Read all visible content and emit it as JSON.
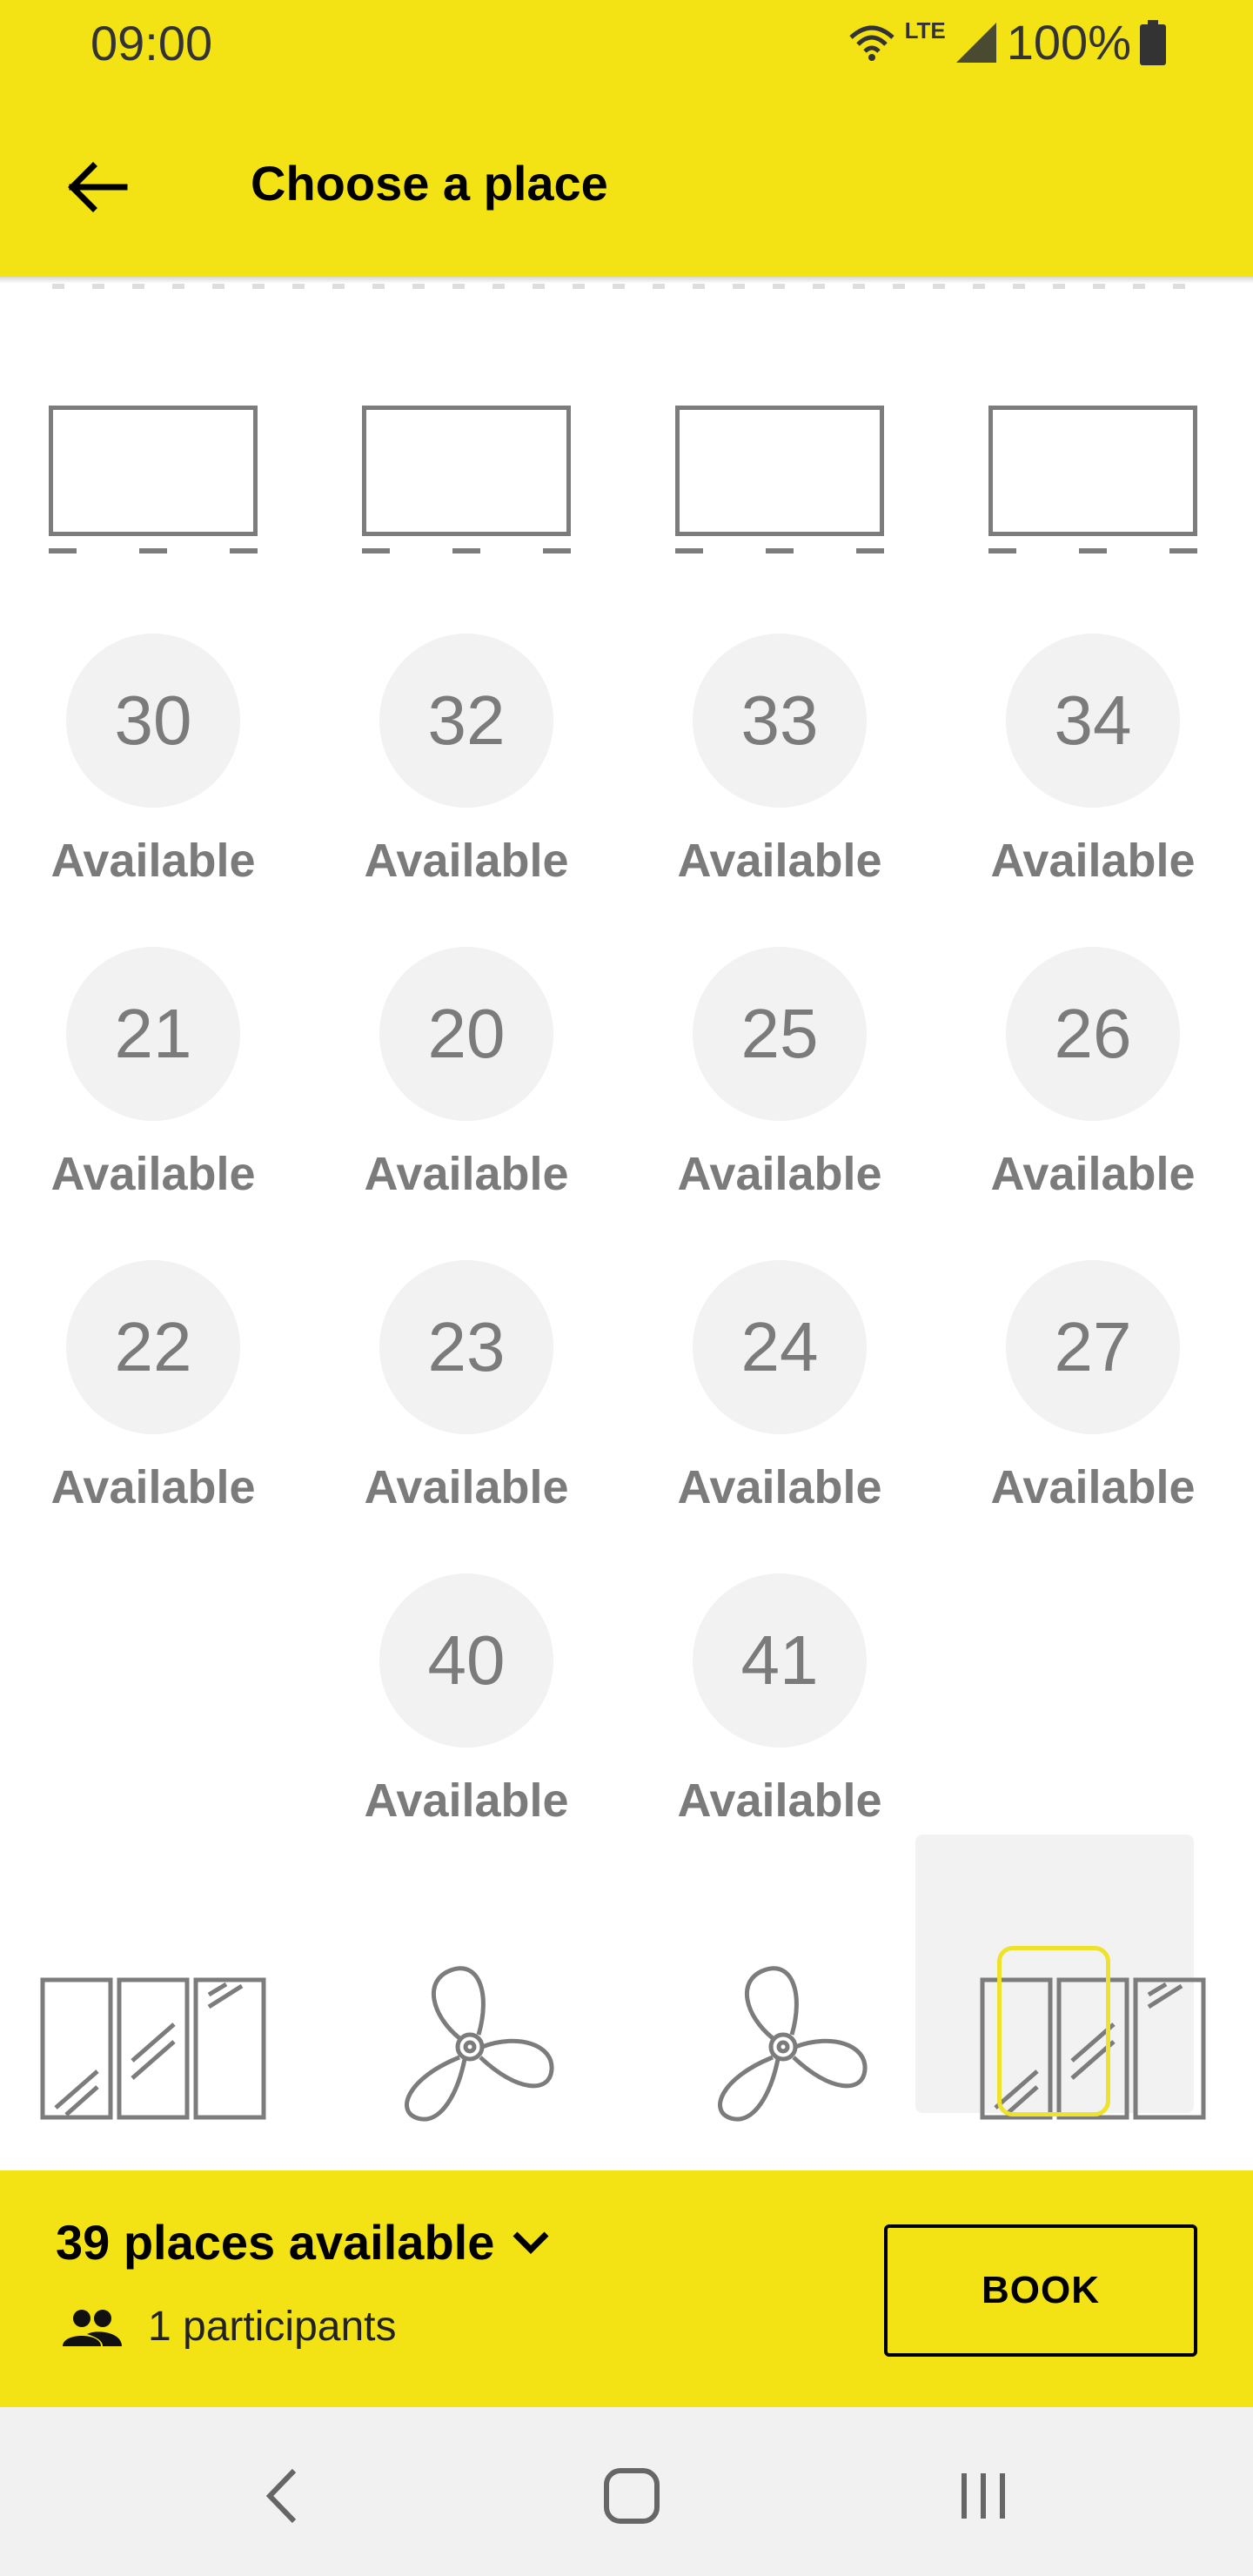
{
  "status_bar": {
    "time": "09:00",
    "network": "LTE",
    "battery": "100%",
    "icons": [
      "wifi-icon",
      "lte-icon",
      "signal-icon",
      "battery-icon"
    ]
  },
  "app_bar": {
    "title": "Choose a place",
    "back_icon": "arrow-left-icon",
    "background": "#f3e315"
  },
  "floor_plan": {
    "screens": 4,
    "seat_rows": [
      [
        {
          "number": "30",
          "status": "Available"
        },
        {
          "number": "32",
          "status": "Available"
        },
        {
          "number": "33",
          "status": "Available"
        },
        {
          "number": "34",
          "status": "Available"
        }
      ],
      [
        {
          "number": "21",
          "status": "Available"
        },
        {
          "number": "20",
          "status": "Available"
        },
        {
          "number": "25",
          "status": "Available"
        },
        {
          "number": "26",
          "status": "Available"
        }
      ],
      [
        {
          "number": "22",
          "status": "Available"
        },
        {
          "number": "23",
          "status": "Available"
        },
        {
          "number": "24",
          "status": "Available"
        },
        {
          "number": "27",
          "status": "Available"
        }
      ],
      [
        {
          "number": "40",
          "status": "Available"
        },
        {
          "number": "41",
          "status": "Available"
        }
      ]
    ],
    "decorations": [
      "window-icon",
      "fan-icon",
      "fan-icon",
      "window-icon"
    ],
    "seat_color": "#f2f2f2",
    "text_color": "#7b7b7b",
    "selection_color": "#efe22a"
  },
  "booking_bar": {
    "places_available": "39 places available",
    "participants": "1 participants",
    "book_label": "BOOK",
    "expand_icon": "chevron-down-icon",
    "participants_icon": "people-icon"
  },
  "nav_bar": {
    "buttons": [
      "back-nav-icon",
      "home-nav-icon",
      "recents-nav-icon"
    ]
  }
}
